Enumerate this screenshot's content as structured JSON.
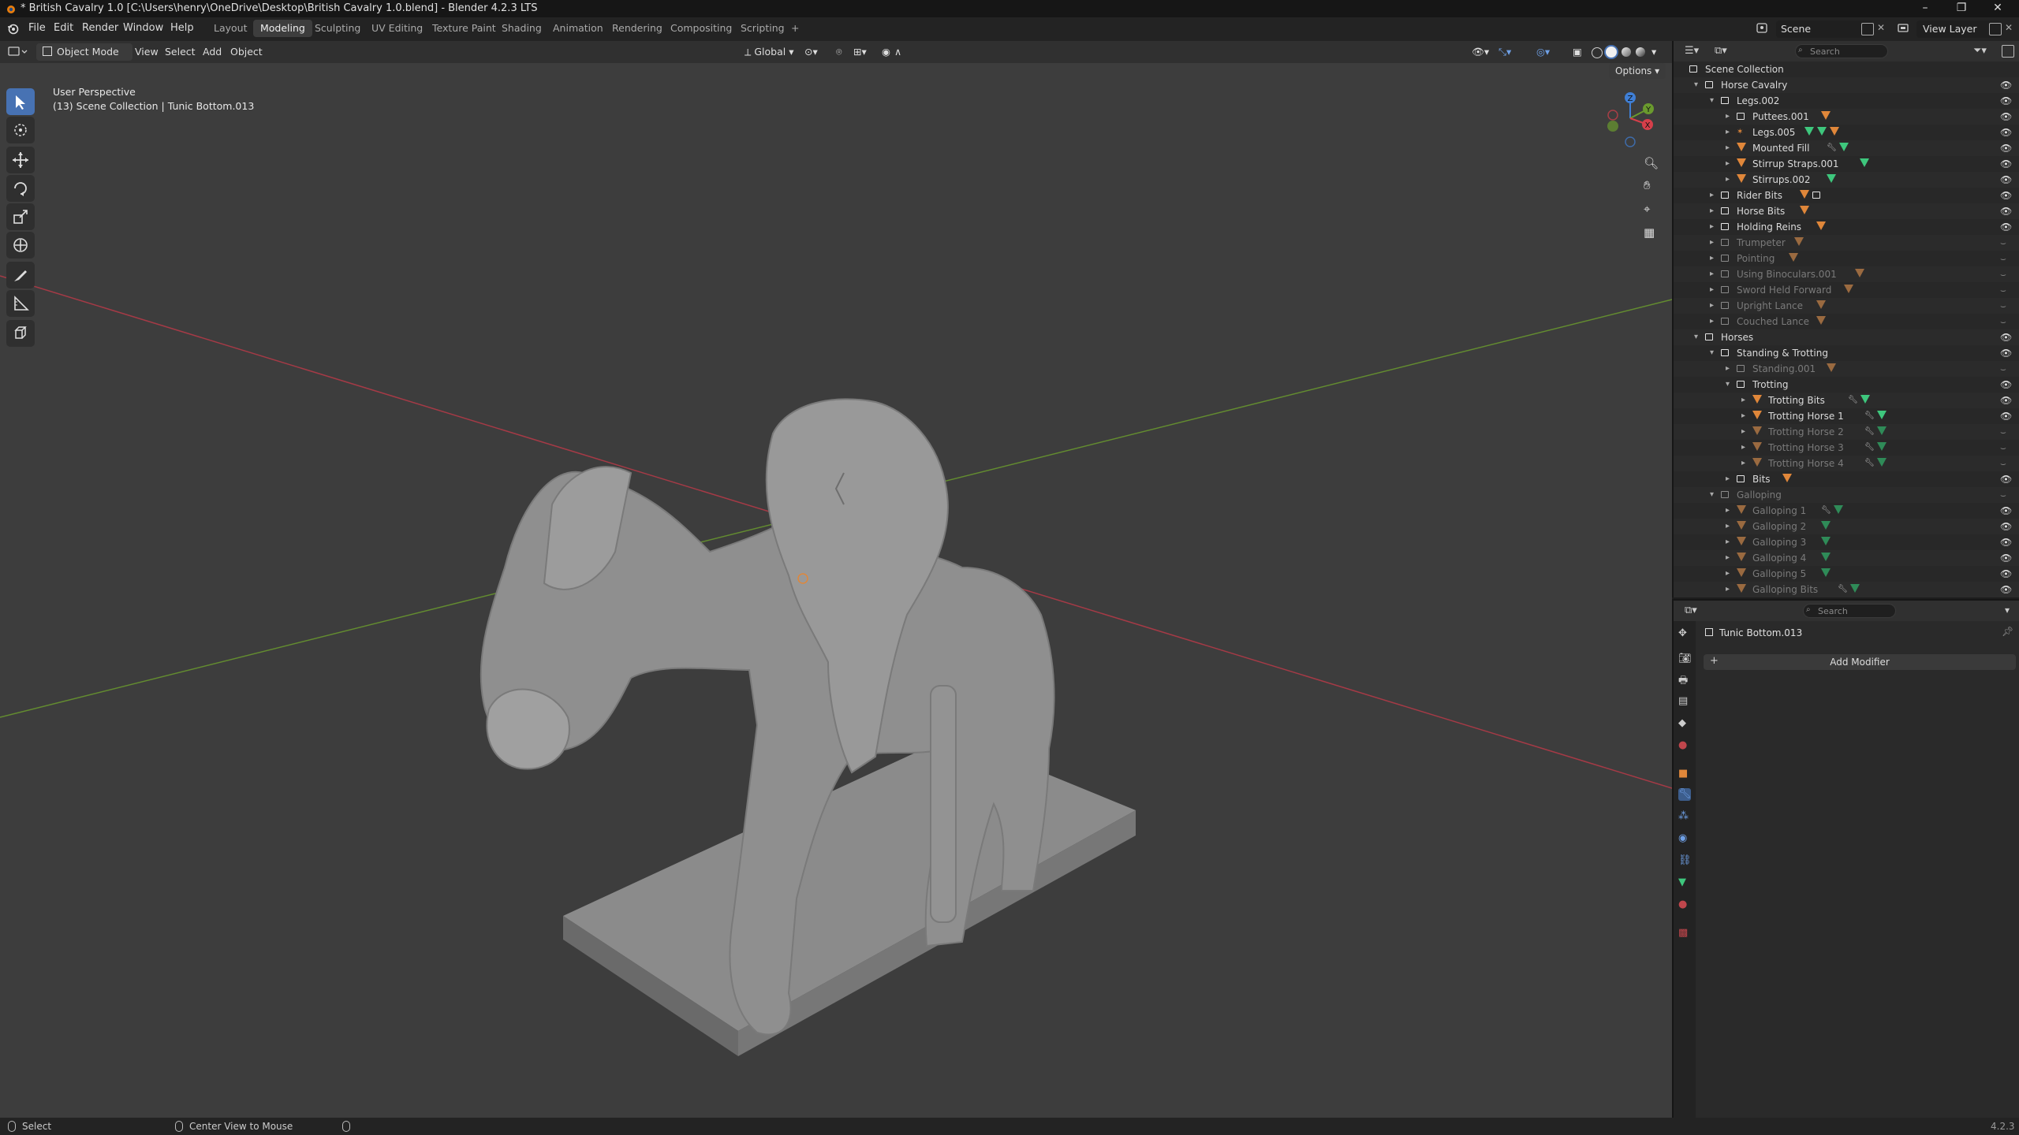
{
  "titlebar": {
    "title": "* British Cavalry 1.0 [C:\\Users\\henry\\OneDrive\\Desktop\\British Cavalry 1.0.blend] - Blender 4.2.3 LTS",
    "minimize": "–",
    "maximize": "❐",
    "close": "✕"
  },
  "menu": {
    "items": [
      "File",
      "Edit",
      "Render",
      "Window",
      "Help"
    ]
  },
  "workspaces": [
    "Layout",
    "Modeling",
    "Sculpting",
    "UV Editing",
    "Texture Paint",
    "Shading",
    "Animation",
    "Rendering",
    "Compositing",
    "Scripting",
    "+"
  ],
  "workspace_active": "Modeling",
  "scene": {
    "label": "Scene",
    "view_layer": "View Layer"
  },
  "viewport_header": {
    "mode": "Object Mode",
    "menus": [
      "View",
      "Select",
      "Add",
      "Object"
    ],
    "orientation": "Global",
    "options": "Options"
  },
  "viewport": {
    "perspective": "User Perspective",
    "collection_info": "(13) Scene Collection | Tunic Bottom.013",
    "gizmo_axes": {
      "x": "X",
      "y": "Y",
      "z": "Z"
    }
  },
  "outliner": {
    "search_placeholder": "Search",
    "rows": [
      {
        "label": "Scene Collection",
        "type": "scene",
        "depth": 0,
        "dim": false,
        "expanded": true,
        "eye": false,
        "icons": []
      },
      {
        "label": "Horse Cavalry",
        "type": "collection",
        "depth": 1,
        "dim": false,
        "expanded": true,
        "eye": true,
        "icons": []
      },
      {
        "label": "Legs.002",
        "type": "collection",
        "depth": 2,
        "dim": false,
        "expanded": true,
        "eye": true,
        "icons": []
      },
      {
        "label": "Puttees.001",
        "type": "collection",
        "depth": 3,
        "dim": false,
        "expanded": false,
        "eye": true,
        "icons": [
          "mesh"
        ]
      },
      {
        "label": "Legs.005",
        "type": "armature",
        "depth": 3,
        "dim": false,
        "expanded": false,
        "eye": true,
        "icons": [
          "green",
          "green",
          "mesh"
        ]
      },
      {
        "label": "Mounted Fill",
        "type": "mesh",
        "depth": 3,
        "dim": false,
        "expanded": false,
        "eye": true,
        "icons": [
          "mod",
          "green"
        ]
      },
      {
        "label": "Stirrup Straps.001",
        "type": "mesh",
        "depth": 3,
        "dim": false,
        "expanded": false,
        "eye": true,
        "icons": [
          "green"
        ]
      },
      {
        "label": "Stirrups.002",
        "type": "mesh",
        "depth": 3,
        "dim": false,
        "expanded": false,
        "eye": true,
        "icons": [
          "green"
        ]
      },
      {
        "label": "Rider Bits",
        "type": "collection",
        "depth": 2,
        "dim": false,
        "expanded": false,
        "eye": true,
        "icons": [
          "mesh",
          "coll"
        ]
      },
      {
        "label": "Horse Bits",
        "type": "collection",
        "depth": 2,
        "dim": false,
        "expanded": false,
        "eye": true,
        "icons": [
          "mesh"
        ]
      },
      {
        "label": "Holding Reins",
        "type": "collection",
        "depth": 2,
        "dim": false,
        "expanded": false,
        "eye": true,
        "icons": [
          "mesh"
        ]
      },
      {
        "label": "Trumpeter",
        "type": "collection",
        "depth": 2,
        "dim": true,
        "expanded": false,
        "eye": false,
        "icons": [
          "mesh"
        ]
      },
      {
        "label": "Pointing",
        "type": "collection",
        "depth": 2,
        "dim": true,
        "expanded": false,
        "eye": false,
        "icons": [
          "mesh"
        ]
      },
      {
        "label": "Using Binoculars.001",
        "type": "collection",
        "depth": 2,
        "dim": true,
        "expanded": false,
        "eye": false,
        "icons": [
          "mesh"
        ]
      },
      {
        "label": "Sword Held Forward",
        "type": "collection",
        "depth": 2,
        "dim": true,
        "expanded": false,
        "eye": false,
        "icons": [
          "mesh"
        ]
      },
      {
        "label": "Upright Lance",
        "type": "collection",
        "depth": 2,
        "dim": true,
        "expanded": false,
        "eye": false,
        "icons": [
          "mesh"
        ]
      },
      {
        "label": "Couched Lance",
        "type": "collection",
        "depth": 2,
        "dim": true,
        "expanded": false,
        "eye": false,
        "icons": [
          "mesh"
        ]
      },
      {
        "label": "Horses",
        "type": "collection",
        "depth": 1,
        "dim": false,
        "expanded": true,
        "eye": true,
        "icons": []
      },
      {
        "label": "Standing & Trotting",
        "type": "collection",
        "depth": 2,
        "dim": false,
        "expanded": true,
        "eye": true,
        "icons": []
      },
      {
        "label": "Standing.001",
        "type": "collection",
        "depth": 3,
        "dim": true,
        "expanded": false,
        "eye": false,
        "icons": [
          "mesh"
        ]
      },
      {
        "label": "Trotting",
        "type": "collection",
        "depth": 3,
        "dim": false,
        "expanded": true,
        "eye": true,
        "icons": []
      },
      {
        "label": "Trotting Bits",
        "type": "mesh",
        "depth": 4,
        "dim": false,
        "expanded": false,
        "eye": true,
        "icons": [
          "mod",
          "green"
        ]
      },
      {
        "label": "Trotting Horse 1",
        "type": "mesh",
        "depth": 4,
        "dim": false,
        "expanded": false,
        "eye": true,
        "icons": [
          "mod",
          "green"
        ]
      },
      {
        "label": "Trotting Horse 2",
        "type": "mesh",
        "depth": 4,
        "dim": true,
        "expanded": false,
        "eye": false,
        "icons": [
          "mod",
          "green"
        ]
      },
      {
        "label": "Trotting Horse 3",
        "type": "mesh",
        "depth": 4,
        "dim": true,
        "expanded": false,
        "eye": false,
        "icons": [
          "mod",
          "green"
        ]
      },
      {
        "label": "Trotting Horse 4",
        "type": "mesh",
        "depth": 4,
        "dim": true,
        "expanded": false,
        "eye": false,
        "icons": [
          "mod",
          "green"
        ]
      },
      {
        "label": "Bits",
        "type": "collection",
        "depth": 3,
        "dim": false,
        "expanded": false,
        "eye": true,
        "icons": [
          "mesh"
        ]
      },
      {
        "label": "Galloping",
        "type": "collection",
        "depth": 2,
        "dim": true,
        "expanded": true,
        "eye": false,
        "icons": []
      },
      {
        "label": "Galloping 1",
        "type": "mesh",
        "depth": 3,
        "dim": true,
        "expanded": false,
        "eye": true,
        "icons": [
          "mod",
          "green"
        ]
      },
      {
        "label": "Galloping 2",
        "type": "mesh",
        "depth": 3,
        "dim": true,
        "expanded": false,
        "eye": true,
        "icons": [
          "green"
        ]
      },
      {
        "label": "Galloping 3",
        "type": "mesh",
        "depth": 3,
        "dim": true,
        "expanded": false,
        "eye": true,
        "icons": [
          "green"
        ]
      },
      {
        "label": "Galloping 4",
        "type": "mesh",
        "depth": 3,
        "dim": true,
        "expanded": false,
        "eye": true,
        "icons": [
          "green"
        ]
      },
      {
        "label": "Galloping 5",
        "type": "mesh",
        "depth": 3,
        "dim": true,
        "expanded": false,
        "eye": true,
        "icons": [
          "green"
        ]
      },
      {
        "label": "Galloping Bits",
        "type": "mesh",
        "depth": 3,
        "dim": true,
        "expanded": false,
        "eye": true,
        "icons": [
          "mod",
          "green"
        ]
      }
    ]
  },
  "properties": {
    "search_placeholder": "Search",
    "object_name": "Tunic Bottom.013",
    "add_modifier": "Add Modifier"
  },
  "statusbar": {
    "left": "Select",
    "middle": "Center View to Mouse",
    "version": "4.2.3"
  },
  "colors": {
    "accent_blue": "#4772b3",
    "mesh_orange": "#e0873a",
    "data_green": "#3ec77d",
    "axis_red": "#b83a48",
    "axis_green": "#6a9a2e"
  }
}
